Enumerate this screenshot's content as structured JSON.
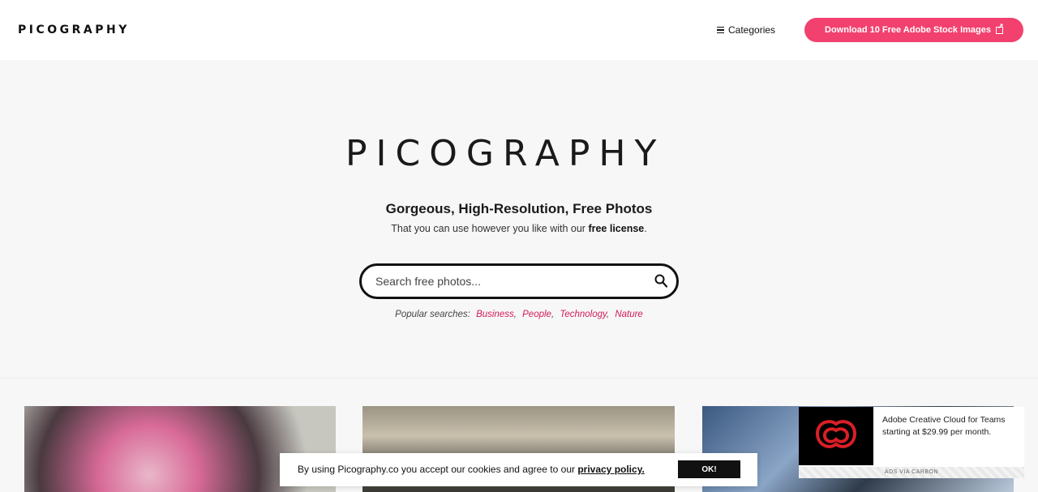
{
  "header": {
    "logo": "PICOGRAPHY",
    "categories_label": "Categories",
    "download_button": "Download 10 Free Adobe Stock Images"
  },
  "hero": {
    "logo": "PICOGRAPHY",
    "title": "Gorgeous, High-Resolution, Free Photos",
    "subtitle_prefix": "That you can use however you like with our",
    "subtitle_link": "free license",
    "subtitle_suffix": "."
  },
  "search": {
    "placeholder": "Search free photos..."
  },
  "popular": {
    "label": "Popular searches:",
    "tags": [
      "Business",
      "People",
      "Technology",
      "Nature"
    ]
  },
  "ad": {
    "text": "Adobe Creative Cloud for Teams starting at $29.99 per month.",
    "via": "ADS VIA CARBON"
  },
  "cookie": {
    "text": "By using Picography.co you accept our cookies and agree to our",
    "link": "privacy policy.",
    "ok_label": "OK!"
  },
  "colors": {
    "accent": "#f2416f",
    "tag": "#d21b5c",
    "adobe_red": "#da1f26"
  },
  "icons": [
    "menu-icon",
    "external-link-icon",
    "search-icon",
    "adobe-cc-icon"
  ]
}
